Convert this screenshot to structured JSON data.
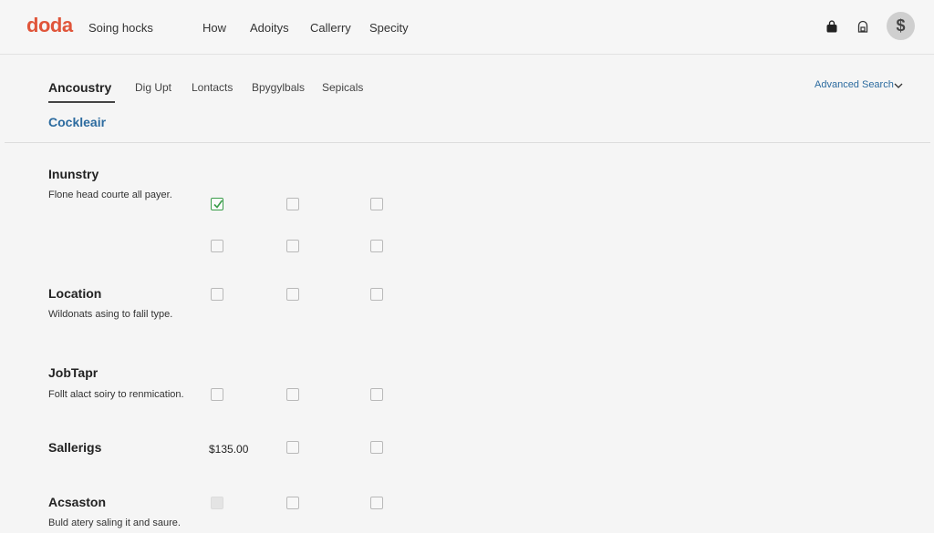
{
  "header": {
    "logo": "doda",
    "tagline": "Soing hocks",
    "nav": [
      "How",
      "Adoitys",
      "Callerry",
      "Specity"
    ],
    "avatar": "$",
    "icons": [
      "bag-icon",
      "lock-icon"
    ]
  },
  "tabs": {
    "items": [
      "Ancoustry",
      "Dig Upt",
      "Lontacts",
      "Bpygylbals",
      "Sepicals"
    ],
    "active": "Ancoustry"
  },
  "advanced_search": {
    "label": "Advanced Search",
    "icon": "chevron-down-icon"
  },
  "subheading": "Cockleair",
  "sections": [
    {
      "title": "Inunstry",
      "desc": "Flone head courte all payer."
    },
    {
      "title": "Location",
      "desc": "Wildonats asing to falil type."
    },
    {
      "title": "JobTapr",
      "desc": "Follt alact soiry to renmication."
    },
    {
      "title": "Sallerigs",
      "desc": "",
      "value": "$135.00"
    },
    {
      "title": "Acsaston",
      "desc": "Buld atery saling it and saure."
    }
  ],
  "checkboxes": {
    "inunstry_row1": [
      true,
      false,
      false
    ],
    "inunstry_row2": [
      false,
      false,
      false
    ],
    "location": [
      false,
      false,
      false
    ],
    "jobtapr": [
      false,
      false,
      false
    ],
    "sallerigs": [
      false,
      false
    ],
    "acsaston": [
      false,
      false,
      false
    ],
    "acsaston_first_disabled": true
  },
  "colors": {
    "brand": "#e0553a",
    "link": "#2c6b9f",
    "check": "#3a9d4a"
  }
}
